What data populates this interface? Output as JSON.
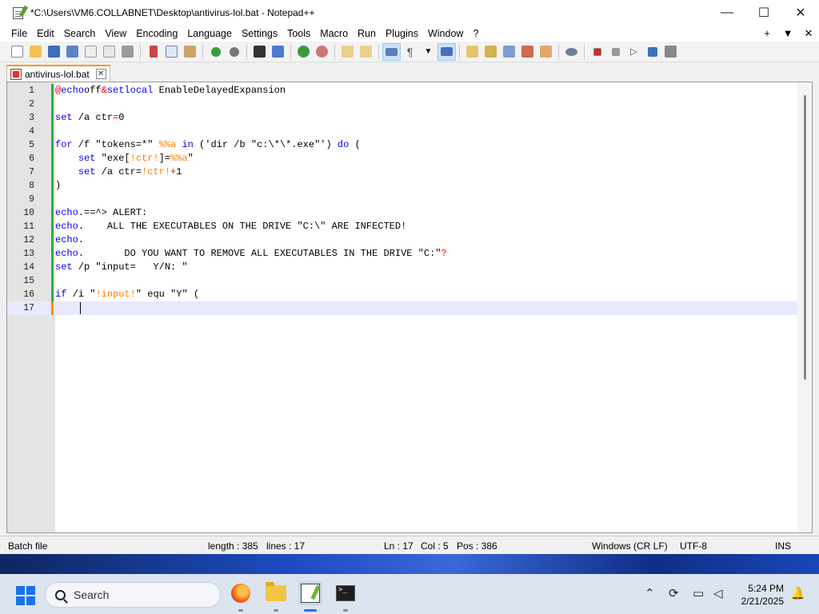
{
  "window": {
    "title": "*C:\\Users\\VM6.COLLABNET\\Desktop\\antivirus-lol.bat - Notepad++",
    "controls": {
      "minimize": "—",
      "maximize": "☐",
      "close": "✕"
    }
  },
  "menu": {
    "items": [
      "File",
      "Edit",
      "Search",
      "View",
      "Encoding",
      "Language",
      "Settings",
      "Tools",
      "Macro",
      "Run",
      "Plugins",
      "Window",
      "?"
    ],
    "right": [
      "+",
      "▼",
      "✕"
    ]
  },
  "toolbar": {
    "icons": [
      "new-file-icon",
      "open-file-icon",
      "save-icon",
      "save-all-icon",
      "close-icon",
      "close-all-icon",
      "print-icon",
      "cut-icon",
      "copy-icon",
      "paste-icon",
      "undo-icon",
      "redo-icon",
      "find-icon",
      "replace-icon",
      "zoom-in-icon",
      "zoom-out-icon",
      "sync-vertical-icon",
      "sync-horizontal-icon",
      "word-wrap-icon",
      "show-all-characters-icon",
      "indent-guide-icon",
      "user-defined-language-icon",
      "doc-map-icon",
      "function-list-icon",
      "folder-as-workspace-icon",
      "monitoring-icon",
      "record-macro-icon",
      "stop-recording-icon",
      "playback-macro-icon",
      "run-macro-multiple-icon",
      "save-macro-icon"
    ]
  },
  "tab": {
    "label": "antivirus-lol.bat",
    "close": "✕"
  },
  "editor": {
    "lines": [
      {
        "n": "1",
        "tokens": [
          [
            "op",
            "@"
          ],
          [
            "kw",
            "echo"
          ],
          [
            "",
            "off"
          ],
          [
            "op",
            "&"
          ],
          [
            "kw",
            "setlocal"
          ],
          [
            "",
            " EnableDelayedExpansion"
          ]
        ]
      },
      {
        "n": "2",
        "tokens": []
      },
      {
        "n": "3",
        "tokens": [
          [
            "kw",
            "set"
          ],
          [
            "",
            " /a ctr"
          ],
          [
            "op",
            "="
          ],
          [
            "",
            "0"
          ]
        ]
      },
      {
        "n": "4",
        "tokens": []
      },
      {
        "n": "5",
        "tokens": [
          [
            "kw",
            "for"
          ],
          [
            "",
            " /f \"tokens=*\" "
          ],
          [
            "var",
            "%%a"
          ],
          [
            "",
            " "
          ],
          [
            "kw",
            "in"
          ],
          [
            "",
            " ('dir /b \"c:\\*\\*.exe\"') "
          ],
          [
            "kw",
            "do"
          ],
          [
            "",
            " ("
          ]
        ]
      },
      {
        "n": "6",
        "tokens": [
          [
            "",
            "    "
          ],
          [
            "kw",
            "set"
          ],
          [
            "",
            " \"exe["
          ],
          [
            "var",
            "!ctr!"
          ],
          [
            "",
            "]="
          ],
          [
            "var",
            "%%a"
          ],
          [
            "",
            "\""
          ]
        ]
      },
      {
        "n": "7",
        "tokens": [
          [
            "",
            "    "
          ],
          [
            "kw",
            "set"
          ],
          [
            "",
            " /a ctr="
          ],
          [
            "var",
            "!ctr!"
          ],
          [
            "op",
            "+"
          ],
          [
            "",
            "1"
          ]
        ]
      },
      {
        "n": "8",
        "tokens": [
          [
            "",
            ")"
          ]
        ]
      },
      {
        "n": "9",
        "tokens": []
      },
      {
        "n": "10",
        "tokens": [
          [
            "kw",
            "echo"
          ],
          [
            "",
            ".==^> ALERT:"
          ]
        ]
      },
      {
        "n": "11",
        "tokens": [
          [
            "kw",
            "echo"
          ],
          [
            "",
            ".    ALL THE EXECUTABLES ON THE DRIVE \"C:\\\" ARE INFECTED!"
          ]
        ]
      },
      {
        "n": "12",
        "tokens": [
          [
            "kw",
            "echo"
          ],
          [
            "",
            "."
          ]
        ]
      },
      {
        "n": "13",
        "tokens": [
          [
            "kw",
            "echo"
          ],
          [
            "",
            ".       DO YOU WANT TO REMOVE ALL EXECUTABLES IN THE DRIVE \"C:\""
          ],
          [
            "op",
            "?"
          ]
        ]
      },
      {
        "n": "14",
        "tokens": [
          [
            "kw",
            "set"
          ],
          [
            "",
            " /p \"input=   Y/N: \""
          ]
        ]
      },
      {
        "n": "15",
        "tokens": []
      },
      {
        "n": "16",
        "tokens": [
          [
            "kw",
            "if"
          ],
          [
            "",
            " /i \""
          ],
          [
            "var",
            "!input!"
          ],
          [
            "",
            "\" equ \"Y\" ("
          ]
        ]
      },
      {
        "n": "17",
        "tokens": [
          [
            "",
            "    "
          ]
        ]
      }
    ],
    "current_line": "17"
  },
  "status": {
    "filetype": "Batch file",
    "length": "length : 385",
    "lines": "lines : 17",
    "ln": "Ln : 17",
    "col": "Col : 5",
    "pos": "Pos : 386",
    "eol": "Windows (CR LF)",
    "encoding": "UTF-8",
    "mode": "INS"
  },
  "taskbar": {
    "search_placeholder": "Search",
    "time": "5:24 PM",
    "date": "2/21/2025",
    "apps": [
      "firefox-icon",
      "file-explorer-icon",
      "notepad-plus-plus-icon",
      "terminal-icon"
    ],
    "tray": {
      "chevron": "⌃",
      "notifications": "🔔"
    }
  }
}
